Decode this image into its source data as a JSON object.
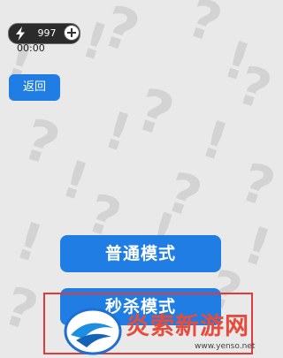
{
  "hud": {
    "energy_count": "997",
    "timer": "00:00"
  },
  "back_label": "返回",
  "modes": {
    "normal_label": "普通模式",
    "second_label": "秒杀模式"
  },
  "watermark": {
    "title": "炎索新游网",
    "url": "www.yenso.net"
  },
  "colors": {
    "button_blue": "#1f7de4",
    "highlight_red": "#e03a3a",
    "background": "#e9e9e9"
  },
  "icons": [
    "lightning-bolt-icon",
    "plus-icon",
    "question-mark-pattern",
    "exclamation-mark-pattern"
  ]
}
